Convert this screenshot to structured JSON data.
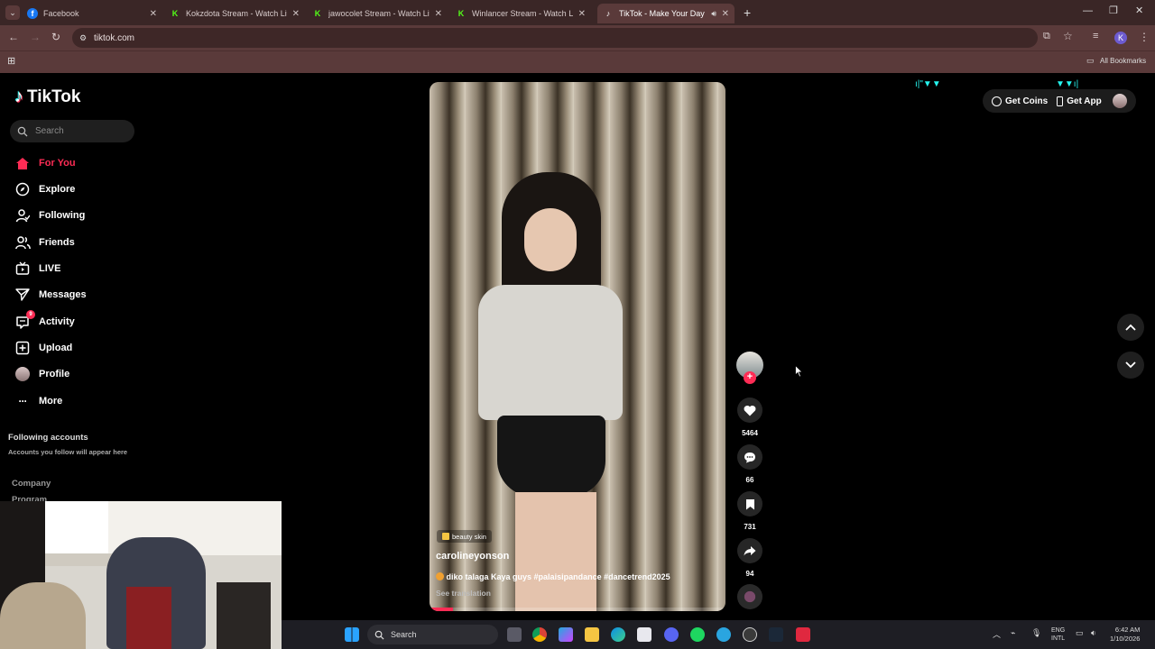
{
  "browser": {
    "tabs": [
      {
        "title": "Facebook",
        "icon": "facebook-icon"
      },
      {
        "title": "Kokzdota Stream - Watch Live",
        "icon": "kick-icon"
      },
      {
        "title": "jawocolet Stream - Watch Live",
        "icon": "kick-icon"
      },
      {
        "title": "Winlancer Stream - Watch Live",
        "icon": "kick-icon"
      },
      {
        "title": "TikTok - Make Your Day",
        "icon": "tiktok-icon"
      }
    ],
    "url": "tiktok.com",
    "all_bookmarks": "All Bookmarks",
    "profile_initial": "K"
  },
  "tiktok": {
    "logo": "TikTok",
    "search_placeholder": "Search",
    "nav": [
      {
        "label": "For You",
        "icon": "home-icon"
      },
      {
        "label": "Explore",
        "icon": "compass-icon"
      },
      {
        "label": "Following",
        "icon": "following-icon"
      },
      {
        "label": "Friends",
        "icon": "friends-icon"
      },
      {
        "label": "LIVE",
        "icon": "live-icon"
      },
      {
        "label": "Messages",
        "icon": "messages-icon"
      },
      {
        "label": "Activity",
        "icon": "activity-icon",
        "badge": "9"
      },
      {
        "label": "Upload",
        "icon": "upload-icon"
      },
      {
        "label": "Profile",
        "icon": "profile-icon"
      },
      {
        "label": "More",
        "icon": "more-icon"
      }
    ],
    "following_title": "Following accounts",
    "following_sub": "Accounts you follow will appear here",
    "company": "Company",
    "program": "Program",
    "get_coins": "Get Coins",
    "get_app": "Get App",
    "video": {
      "tag": "beauty skin",
      "username": "carolineyonson",
      "caption": "diko talaga Kaya guys #palaisipandance #dancetrend2025",
      "see_translation": "See translation",
      "likes": "5464",
      "comments": "66",
      "saves": "731",
      "shares": "94"
    },
    "accent": "#fe2c55"
  },
  "taskbar": {
    "search": "Search",
    "lang1": "ENG",
    "lang2": "INTL",
    "time": "6:42 AM",
    "date": "1/10/2026"
  }
}
